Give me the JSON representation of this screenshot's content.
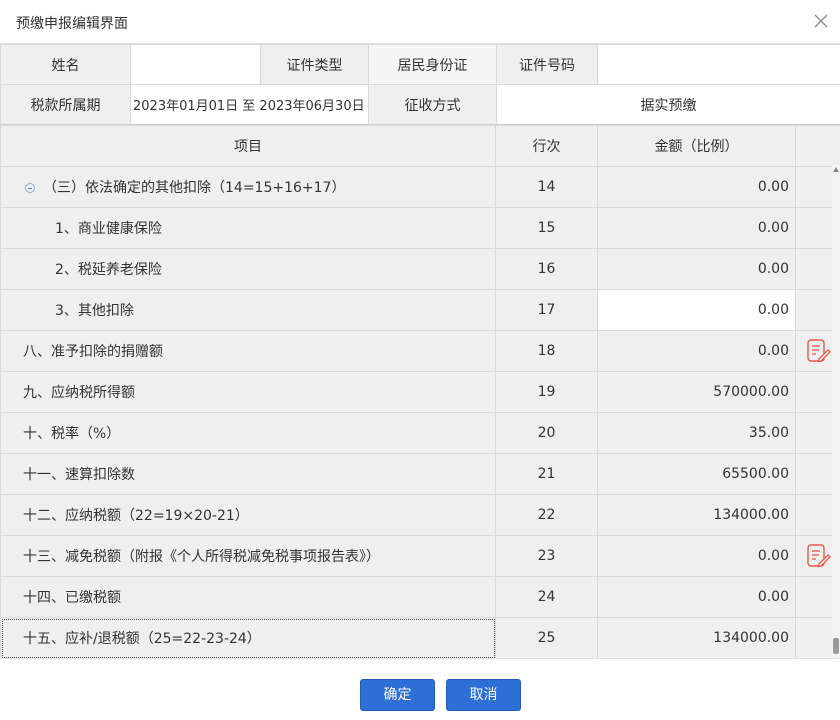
{
  "dialog": {
    "title": "预缴申报编辑界面",
    "icons": {
      "close": "close-icon"
    }
  },
  "info": {
    "name_label": "姓名",
    "name_value": "",
    "id_type_label": "证件类型",
    "id_type_value": "居民身份证",
    "id_number_label": "证件号码",
    "id_number_value": "",
    "period_label": "税款所属期",
    "period_value": "2023年01月01日 至 2023年06月30日",
    "method_label": "征收方式",
    "method_value": "据实预缴"
  },
  "grid": {
    "headers": {
      "item": "项目",
      "line": "行次",
      "amount": "金额（比例）"
    },
    "rows": [
      {
        "item": "（三）依法确定的其他扣除（14=15+16+17）",
        "line": "14",
        "amount": "0.00"
      },
      {
        "item": "1、商业健康保险",
        "line": "15",
        "amount": "0.00"
      },
      {
        "item": "2、税延养老保险",
        "line": "16",
        "amount": "0.00"
      },
      {
        "item": "3、其他扣除",
        "line": "17",
        "amount": "0.00"
      },
      {
        "item": "八、准予扣除的捐赠额",
        "line": "18",
        "amount": "0.00"
      },
      {
        "item": "九、应纳税所得额",
        "line": "19",
        "amount": "570000.00"
      },
      {
        "item": "十、税率（%）",
        "line": "20",
        "amount": "35.00"
      },
      {
        "item": "十一、速算扣除数",
        "line": "21",
        "amount": "65500.00"
      },
      {
        "item": "十二、应纳税额（22=19×20-21）",
        "line": "22",
        "amount": "134000.00"
      },
      {
        "item": "十三、减免税额（附报《个人所得税减免税事项报告表》）",
        "line": "23",
        "amount": "0.00"
      },
      {
        "item": "十四、已缴税额",
        "line": "24",
        "amount": "0.00"
      },
      {
        "item": "十五、应补/退税额（25=22-23-24）",
        "line": "25",
        "amount": "134000.00"
      }
    ]
  },
  "footer": {
    "ok_label": "确定",
    "cancel_label": "取消"
  },
  "colors": {
    "button": "#2d6fd4",
    "edit_icon": "#e8574b",
    "cell_bg": "#efefef"
  }
}
